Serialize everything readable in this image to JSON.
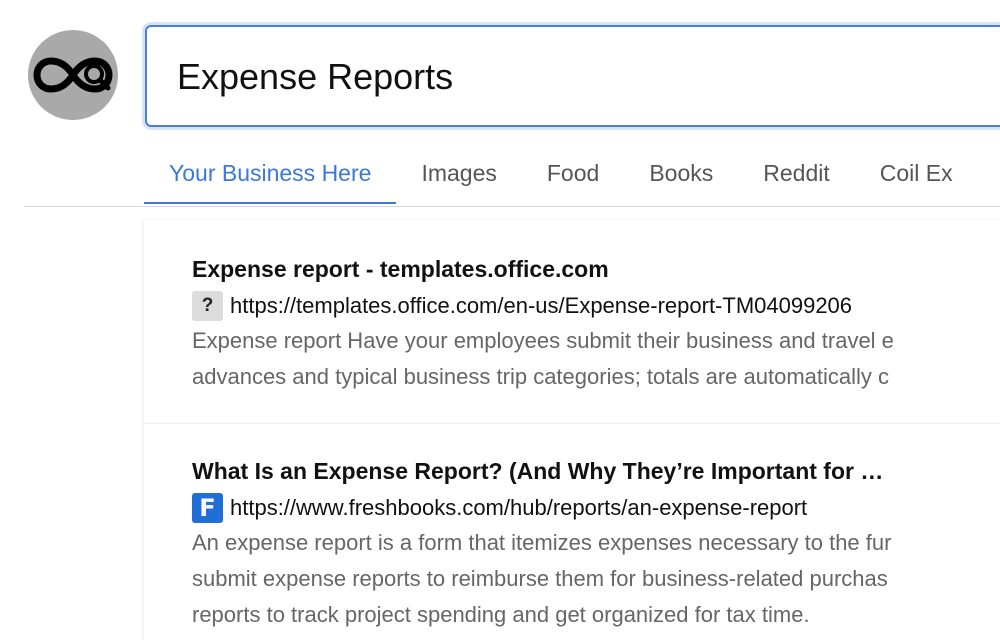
{
  "search": {
    "query": "Expense Reports"
  },
  "tabs": [
    {
      "label": "Your Business Here",
      "active": true
    },
    {
      "label": "Images",
      "active": false
    },
    {
      "label": "Food",
      "active": false
    },
    {
      "label": "Books",
      "active": false
    },
    {
      "label": "Reddit",
      "active": false
    },
    {
      "label": "Coil Ex",
      "active": false
    }
  ],
  "results": [
    {
      "title": "Expense report - templates.office.com",
      "favicon": "question-mark-icon",
      "favicon_glyph": "?",
      "url": "https://templates.office.com/en-us/Expense-report-TM04099206",
      "snippet_lines": [
        "Expense report Have your employees submit their business and travel e",
        "advances and typical business trip categories; totals are automatically c"
      ]
    },
    {
      "title": "What Is an Expense Report? (And Why They’re Important for …",
      "favicon": "freshbooks-icon",
      "favicon_glyph": "F",
      "url": "https://www.freshbooks.com/hub/reports/an-expense-report",
      "snippet_lines": [
        "An expense report is a form that itemizes expenses necessary to the fur",
        "submit expense reports to reimburse them for business-related purchas",
        "reports to track project spending and get organized for tax time."
      ]
    }
  ],
  "colors": {
    "accent": "#3b78d8",
    "logo_bg": "#a9a9a9",
    "freshbooks_blue": "#1f6fd6"
  }
}
